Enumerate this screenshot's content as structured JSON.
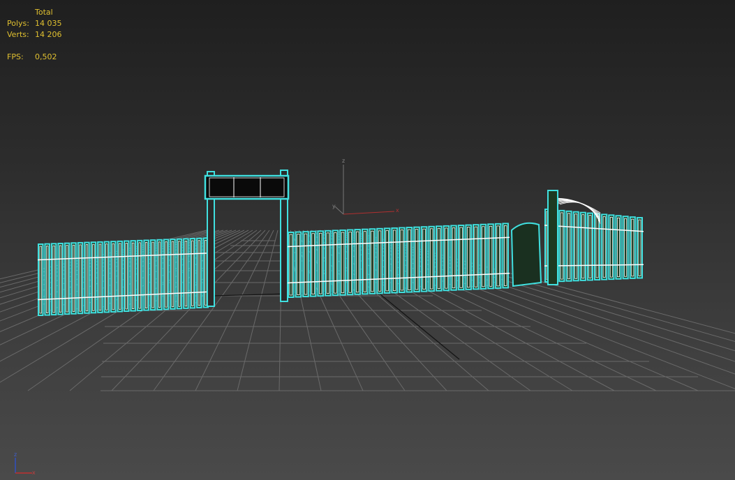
{
  "stats": {
    "header": "Total",
    "polys_label": "Polys:",
    "polys_value": "14 035",
    "verts_label": "Verts:",
    "verts_value": "14 206",
    "fps_label": "FPS:",
    "fps_value": "0,502"
  },
  "gizmo": {
    "z": "z",
    "x": "x",
    "y": "y"
  },
  "colors": {
    "stats_text": "#e0c030",
    "selection_outline": "#40e0e0",
    "wire": "#ffffff",
    "grid": "#6a6a6a",
    "axis_x": "#c03030",
    "axis_z": "#3050c0"
  }
}
